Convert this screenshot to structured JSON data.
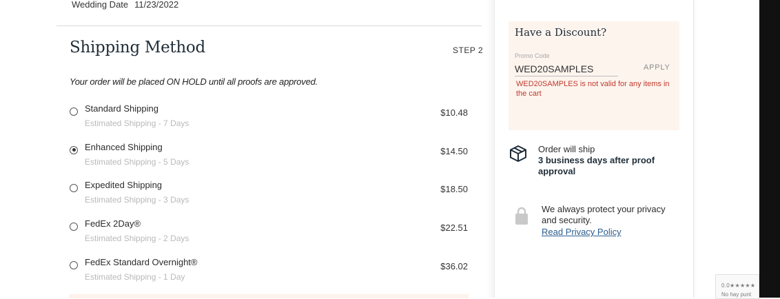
{
  "wedding": {
    "label": "Wedding Date",
    "value": "11/23/2022"
  },
  "shipping": {
    "title": "Shipping Method",
    "step": "STEP 2",
    "note": "Your order will be placed ON HOLD until all proofs are approved.",
    "options": [
      {
        "name": "Standard Shipping",
        "estimate": "Estimated Shipping - 7 Days",
        "price": "$10.48",
        "selected": false
      },
      {
        "name": "Enhanced Shipping",
        "estimate": "Estimated Shipping - 5 Days",
        "price": "$14.50",
        "selected": true
      },
      {
        "name": "Expedited Shipping",
        "estimate": "Estimated Shipping - 3 Days",
        "price": "$18.50",
        "selected": false
      },
      {
        "name": "FedEx 2Day®",
        "estimate": "Estimated Shipping - 2 Days",
        "price": "$22.51",
        "selected": false
      },
      {
        "name": "FedEx Standard Overnight®",
        "estimate": "Estimated Shipping - 1 Day",
        "price": "$36.02",
        "selected": false
      }
    ]
  },
  "discount": {
    "title": "Have a Discount?",
    "promo_label": "Promo Code",
    "promo_value": "WED20SAMPLES",
    "apply_label": "APPLY",
    "error": "WED20SAMPLES is not valid for any items in the cart"
  },
  "ship_info": {
    "lead": "Order will ship",
    "detail": "3 business days after proof approval",
    "icon": "box-icon"
  },
  "privacy": {
    "text": "We always protect your privacy and security.",
    "link": "Read Privacy Policy",
    "icon": "lock-icon"
  },
  "recaptcha": {
    "rating": "0.0★★★★★",
    "text": "No hay punt"
  },
  "colors": {
    "accent_bg": "#fdf4ee",
    "error": "#c0392b",
    "link": "#2a5d8f",
    "heading": "#1f2d38"
  }
}
